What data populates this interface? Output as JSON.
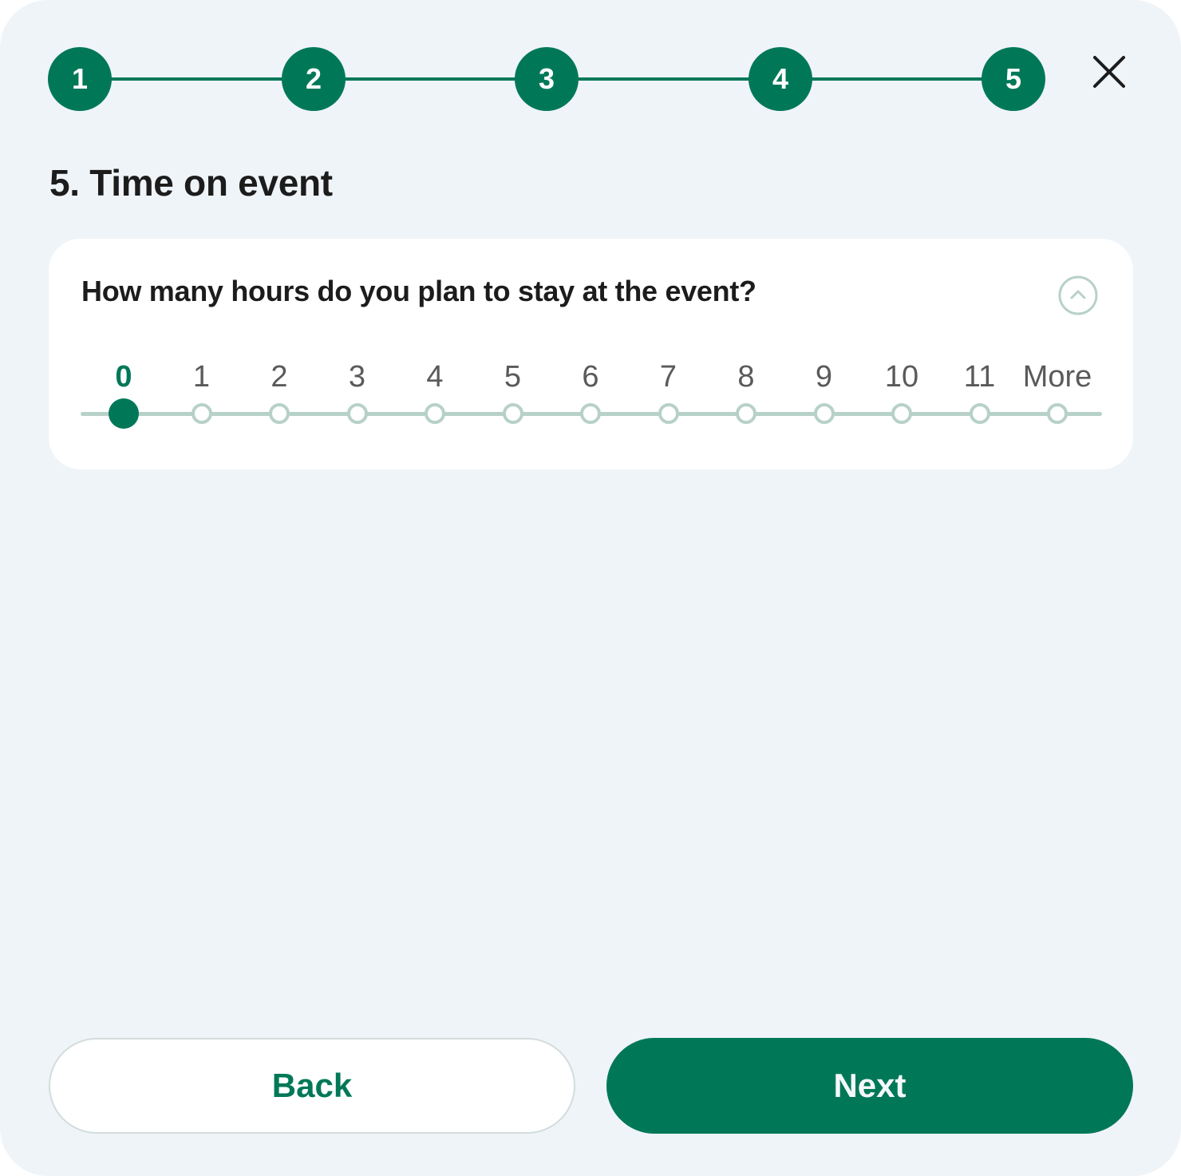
{
  "colors": {
    "accent": "#007858",
    "background": "#eff4f8",
    "card": "#ffffff",
    "track": "#b7d1c8",
    "text": "#1c1c1c",
    "muted_text": "#5a5a5a"
  },
  "stepper": {
    "steps": [
      {
        "label": "1",
        "state": "completed"
      },
      {
        "label": "2",
        "state": "completed"
      },
      {
        "label": "3",
        "state": "completed"
      },
      {
        "label": "4",
        "state": "completed"
      },
      {
        "label": "5",
        "state": "current"
      }
    ],
    "close_icon": "close-icon"
  },
  "page": {
    "title": "5. Time on event"
  },
  "question_card": {
    "question": "How many hours do you plan to stay at the event?",
    "collapse_icon": "chevron-up-circle-icon",
    "slider": {
      "options": [
        "0",
        "1",
        "2",
        "3",
        "4",
        "5",
        "6",
        "7",
        "8",
        "9",
        "10",
        "11",
        "More"
      ],
      "selected_index": 0,
      "selected_value": "0"
    }
  },
  "footer": {
    "back_label": "Back",
    "next_label": "Next"
  }
}
